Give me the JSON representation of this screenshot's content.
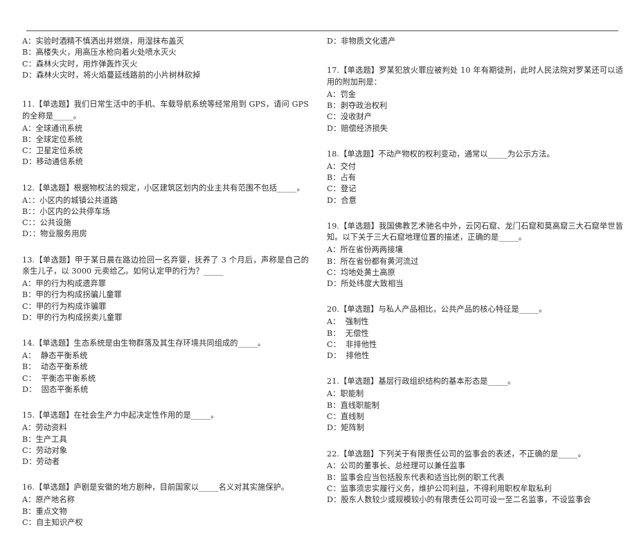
{
  "document": {
    "type": "exam-paper",
    "language": "zh-CN",
    "single_choice_tag": "【单选题】",
    "columns": 2
  },
  "left_column": {
    "continued_options": [
      "A：实验时酒精不慎洒出并燃烧，用湿抹布盖灭",
      "B：高楼失火，用高压水枪向着火处喷水灭火",
      "C：森林火灾时，用炸弹轰炸灭火",
      "D：森林火灾时，将火焰蔓延线路前的小片树林砍掉"
    ],
    "questions": [
      {
        "number": "11.",
        "stem": "11.【单选题】我们日常生活中的手机、车载导航系统等经常用到 GPS，请问 GPS 的全称是_____。",
        "options": [
          "A：全球通讯系统",
          "B：全球定位系统",
          "C：卫星定位系统",
          "D：移动通信系统"
        ]
      },
      {
        "number": "12.",
        "stem": "12.【单选题】根据物权法的规定，小区建筑区划内的业主共有范围不包括_____。",
        "options": [
          "A：：小区内的城镇公共道路",
          "B：：小区内的公共停车场",
          "C：：公共设施",
          "D：：物业服务用房"
        ]
      },
      {
        "number": "13.",
        "stem": "13.【单选题】甲于某日晨在路边捡回一名弃婴，抚养了 3 个月后，声称是自己的亲生儿子，以 3000 元卖给乙。如何认定甲的行为？_____",
        "options": [
          "A：甲的行为构成遗弃罪",
          "B：甲的行为构成拐骗儿童罪",
          "C：甲的行为构成诈骗罪",
          "D：甲的行为构成拐卖儿童罪"
        ]
      },
      {
        "number": "14.",
        "stem": "14.【单选题】生态系统是由生物群落及其生存环境共同组成的_____。",
        "options": [
          "A：  静态平衡系统",
          "B：  动态平衡系统",
          "C：  平衡态平衡系统",
          "D：  固态平衡系统"
        ]
      },
      {
        "number": "15.",
        "stem": "15.【单选题】在社会生产力中起决定性作用的是_____。",
        "options": [
          "A：劳动资料",
          "B：生产工具",
          "C：劳动对象",
          "D：劳动者"
        ]
      },
      {
        "number": "16.",
        "stem": "16.【单选题】庐剧是安徽的地方剧种，目前国家以_____名义对其实施保护。",
        "options": [
          "A：原产地名称",
          "B：重点文物",
          "C：自主知识产权"
        ]
      }
    ]
  },
  "right_column": {
    "continued_options": [
      "D：非物质文化遗产"
    ],
    "questions": [
      {
        "number": "17.",
        "stem": "17.【单选题】罗某犯放火罪应被判处 10 年有期徒刑，此时人民法院对罗某还可以适用的附加刑是：",
        "options": [
          "A：罚金",
          "B：剥夺政治权利",
          "C：没收财产",
          "D：赔偿经济损失"
        ]
      },
      {
        "number": "18.",
        "stem": "18.【单选题】不动产物权的权利变动，通常以_____为公示方法。",
        "options": [
          "A：交付",
          "B：占有",
          "C：登记",
          "D：合意"
        ]
      },
      {
        "number": "19.",
        "stem": "19.【单选题】我国佛教艺术驰名中外，云冈石窟、龙门石窟和莫高窟三大石窟举世皆知。以下关于三大石窟地理位置的描述，正确的是_____。",
        "options": [
          "A：所在省份两两接壤",
          "B：所在省份都有黄河流过",
          "C：均地处黄土高原",
          "D：所处纬度大致相当"
        ]
      },
      {
        "number": "20.",
        "stem": "20.【单选题】与私人产品相比，公共产品的核心特征是_____。",
        "options": [
          "A：  强制性",
          "B：  无偿性",
          "C：  非排他性",
          "D：  排他性"
        ]
      },
      {
        "number": "21.",
        "stem": "21.【单选题】基层行政组织结构的基本形态是_____。",
        "options": [
          "A：职能制",
          "B：直线职能制",
          "C：直线制",
          "D：矩阵制"
        ]
      },
      {
        "number": "22.",
        "stem": "22.【单选题】下列关于有限责任公司的监事会的表述，不正确的是_____。",
        "options": [
          "A：公司的董事长、总经理可以兼任监事",
          "B：监事会应当包括股东代表和适当比例的职工代表",
          "C：监事须忠实履行义务，维护公司利益，不得利用职权牟取私利",
          "D：股东人数较少或规模较小的有限责任公司可设一至二名监事，不设监事会"
        ]
      }
    ]
  }
}
